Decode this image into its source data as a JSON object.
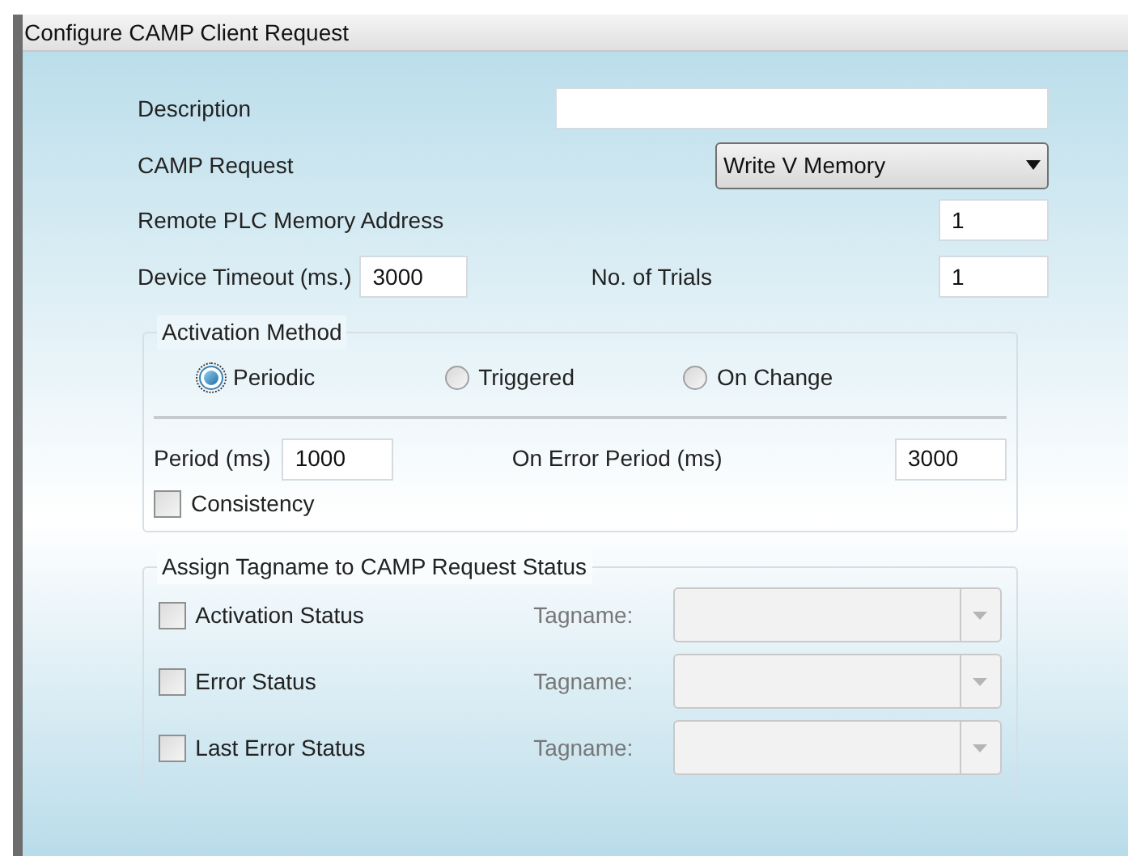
{
  "window": {
    "title": "Configure CAMP Client Request"
  },
  "description": {
    "label": "Description"
  },
  "camp_request": {
    "label": "CAMP Request",
    "value": "Write V Memory"
  },
  "remote_address": {
    "label": "Remote PLC Memory Address",
    "value": "1"
  },
  "device_timeout": {
    "label": "Device Timeout (ms.)",
    "value": "3000"
  },
  "trials": {
    "label": "No. of Trials",
    "value": "1"
  },
  "activation": {
    "title": "Activation Method",
    "methods": [
      {
        "label": "Periodic",
        "selected": true
      },
      {
        "label": "Triggered",
        "selected": false
      },
      {
        "label": "On Change",
        "selected": false
      }
    ],
    "period": {
      "label": "Period (ms)",
      "value": "1000"
    },
    "error_period": {
      "label": "On Error Period (ms)",
      "value": "3000"
    },
    "consistency": {
      "label": "Consistency",
      "checked": false
    }
  },
  "assign": {
    "title": "Assign Tagname to CAMP Request Status",
    "rows": [
      {
        "label": "Activation Status",
        "checked": false,
        "tag_label": "Tagname:"
      },
      {
        "label": "Error Status",
        "checked": false,
        "tag_label": "Tagname:"
      },
      {
        "label": "Last Error Status",
        "checked": false,
        "tag_label": "Tagname:"
      }
    ]
  }
}
